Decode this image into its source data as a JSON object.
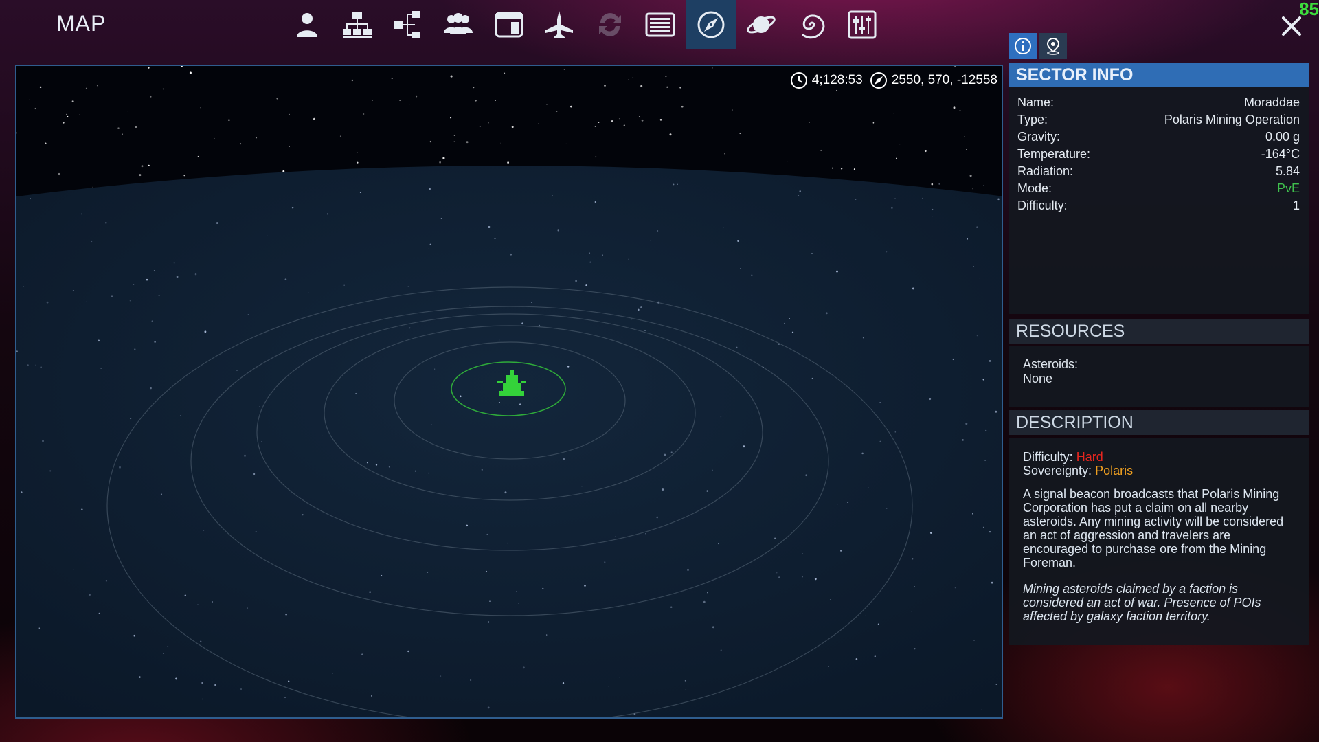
{
  "header": {
    "title": "MAP",
    "fps": "85",
    "nav_items": [
      {
        "name": "character-icon",
        "active": false,
        "disabled": false
      },
      {
        "name": "network-icon",
        "active": false,
        "disabled": false
      },
      {
        "name": "structure-icon",
        "active": false,
        "disabled": false
      },
      {
        "name": "faction-icon",
        "active": false,
        "disabled": false
      },
      {
        "name": "terminal-icon",
        "active": false,
        "disabled": false
      },
      {
        "name": "ship-icon",
        "active": false,
        "disabled": false
      },
      {
        "name": "trade-icon",
        "active": false,
        "disabled": true
      },
      {
        "name": "list-icon",
        "active": false,
        "disabled": false
      },
      {
        "name": "compass-icon",
        "active": true,
        "disabled": false
      },
      {
        "name": "planet-icon",
        "active": false,
        "disabled": false
      },
      {
        "name": "galaxy-icon",
        "active": false,
        "disabled": false
      },
      {
        "name": "settings-sliders-icon",
        "active": false,
        "disabled": false
      }
    ]
  },
  "hud": {
    "time": "4;128:53",
    "coordinates": "2550, 570, -12558"
  },
  "sector_info": {
    "header": "SECTOR INFO",
    "rows": [
      {
        "label": "Name:",
        "value": "Moraddae"
      },
      {
        "label": "Type:",
        "value": "Polaris Mining Operation"
      },
      {
        "label": "Gravity:",
        "value": "0.00 g"
      },
      {
        "label": "Temperature:",
        "value": "-164°C"
      },
      {
        "label": "Radiation:",
        "value": "5.84"
      },
      {
        "label": "Mode:",
        "value": "PvE"
      },
      {
        "label": "Difficulty:",
        "value": "1"
      }
    ]
  },
  "resources": {
    "header": "RESOURCES",
    "label": "Asteroids:",
    "value": "None"
  },
  "description": {
    "header": "DESCRIPTION",
    "difficulty_label": "Difficulty:",
    "difficulty_value": "Hard",
    "sovereignty_label": "Sovereignty:",
    "sovereignty_value": "Polaris",
    "text": "A signal beacon broadcasts that Polaris Mining Corporation has put a claim on all nearby asteroids. Any mining activity will be considered an act of aggression and travelers are encouraged to purchase ore from the Mining Foreman.",
    "note": "Mining asteroids claimed by a faction is considered an act of war. Presence of POIs affected by galaxy faction territory."
  },
  "colors": {
    "accent_blue": "#2f6db5",
    "active_nav": "#1e3f63",
    "pve_green": "#3fbf4d",
    "hard_red": "#e6261f",
    "polaris_orange": "#f0a020",
    "fps_green": "#3ddc3d"
  }
}
